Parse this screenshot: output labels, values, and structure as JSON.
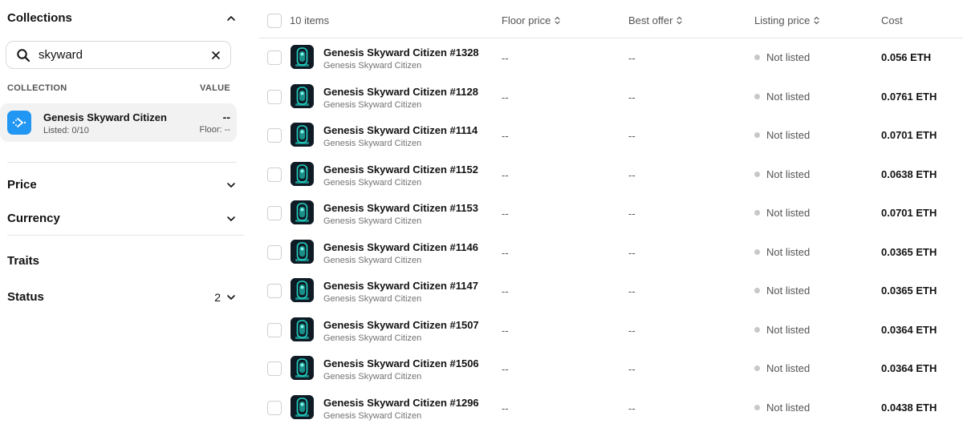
{
  "sidebar": {
    "collections_title": "Collections",
    "search": {
      "value": "skyward",
      "placeholder": "Search"
    },
    "collection_header": "COLLECTION",
    "value_header": "VALUE",
    "collection_card": {
      "name": "Genesis Skyward Citizen",
      "listed": "Listed: 0/10",
      "value": "--",
      "floor": "Floor: --"
    },
    "filters": {
      "price": "Price",
      "currency": "Currency",
      "traits": "Traits",
      "status": "Status",
      "status_count": "2"
    }
  },
  "table": {
    "items_count": "10 items",
    "headers": {
      "floor_price": "Floor price",
      "best_offer": "Best offer",
      "listing_price": "Listing price",
      "cost": "Cost"
    },
    "rows": [
      {
        "name": "Genesis Skyward Citizen #1328",
        "collection": "Genesis Skyward Citizen",
        "floor": "--",
        "best_offer": "--",
        "listing": "Not listed",
        "cost": "0.056 ETH"
      },
      {
        "name": "Genesis Skyward Citizen #1128",
        "collection": "Genesis Skyward Citizen",
        "floor": "--",
        "best_offer": "--",
        "listing": "Not listed",
        "cost": "0.0761 ETH"
      },
      {
        "name": "Genesis Skyward Citizen #1114",
        "collection": "Genesis Skyward Citizen",
        "floor": "--",
        "best_offer": "--",
        "listing": "Not listed",
        "cost": "0.0701 ETH"
      },
      {
        "name": "Genesis Skyward Citizen #1152",
        "collection": "Genesis Skyward Citizen",
        "floor": "--",
        "best_offer": "--",
        "listing": "Not listed",
        "cost": "0.0638 ETH"
      },
      {
        "name": "Genesis Skyward Citizen #1153",
        "collection": "Genesis Skyward Citizen",
        "floor": "--",
        "best_offer": "--",
        "listing": "Not listed",
        "cost": "0.0701 ETH"
      },
      {
        "name": "Genesis Skyward Citizen #1146",
        "collection": "Genesis Skyward Citizen",
        "floor": "--",
        "best_offer": "--",
        "listing": "Not listed",
        "cost": "0.0365 ETH"
      },
      {
        "name": "Genesis Skyward Citizen #1147",
        "collection": "Genesis Skyward Citizen",
        "floor": "--",
        "best_offer": "--",
        "listing": "Not listed",
        "cost": "0.0365 ETH"
      },
      {
        "name": "Genesis Skyward Citizen #1507",
        "collection": "Genesis Skyward Citizen",
        "floor": "--",
        "best_offer": "--",
        "listing": "Not listed",
        "cost": "0.0364 ETH"
      },
      {
        "name": "Genesis Skyward Citizen #1506",
        "collection": "Genesis Skyward Citizen",
        "floor": "--",
        "best_offer": "--",
        "listing": "Not listed",
        "cost": "0.0364 ETH"
      },
      {
        "name": "Genesis Skyward Citizen #1296",
        "collection": "Genesis Skyward Citizen",
        "floor": "--",
        "best_offer": "--",
        "listing": "Not listed",
        "cost": "0.0438 ETH"
      }
    ]
  },
  "colors": {
    "accent": "#2196f3",
    "thumb_bg": "#0f1b24",
    "thumb_glow": "#22d3c5",
    "not_listed_dot": "#c8c8c8"
  },
  "icons": {
    "search": "search-icon",
    "clear": "close-icon",
    "collapse": "chevron-up-icon",
    "expand": "chevron-down-icon",
    "sort": "sort-icon",
    "collection_logo": "collection-logo-icon"
  }
}
